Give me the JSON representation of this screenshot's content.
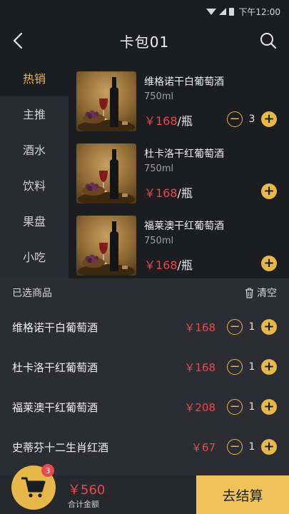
{
  "status_bar": {
    "time": "下午12:00"
  },
  "header": {
    "title": "卡包01"
  },
  "sidebar": {
    "items": [
      {
        "label": "热销"
      },
      {
        "label": "主推"
      },
      {
        "label": "酒水"
      },
      {
        "label": "饮料"
      },
      {
        "label": "果盘"
      },
      {
        "label": "小吃"
      }
    ]
  },
  "products": [
    {
      "name": "维格诺干白葡萄酒",
      "volume": "750ml",
      "price": "￥168",
      "unit": "/瓶",
      "minus": "−",
      "qty": "3",
      "plus": "+"
    },
    {
      "name": "杜卡洛干红葡萄酒",
      "volume": "750ml",
      "price": "￥168",
      "unit": "/瓶",
      "plus": "+"
    },
    {
      "name": "福莱澳干红葡萄酒",
      "volume": "750ml",
      "price": "￥168",
      "unit": "/瓶",
      "plus": "+"
    }
  ],
  "cart": {
    "heading": "已选商品",
    "clear_label": "清空",
    "items": [
      {
        "name": "维格诺干白葡萄酒",
        "price": "￥168",
        "minus": "−",
        "qty": "1",
        "plus": "+"
      },
      {
        "name": "杜卡洛干红葡萄酒",
        "price": "￥168",
        "minus": "−",
        "qty": "1",
        "plus": "+"
      },
      {
        "name": "福莱澳干红葡萄酒",
        "price": "￥208",
        "minus": "−",
        "qty": "1",
        "plus": "+"
      },
      {
        "name": "史蒂芬十二生肖红酒",
        "price": "￥67",
        "minus": "−",
        "qty": "1",
        "plus": "+"
      }
    ]
  },
  "bottom": {
    "badge": "3",
    "total": "￥560",
    "total_label": "合计金额",
    "checkout": "去结算"
  },
  "colors": {
    "accent": "#e6b84a",
    "price": "#e8484f",
    "background": "#1c1d21",
    "sidebar": "#2a2b30",
    "panel": "#2c2d32"
  }
}
